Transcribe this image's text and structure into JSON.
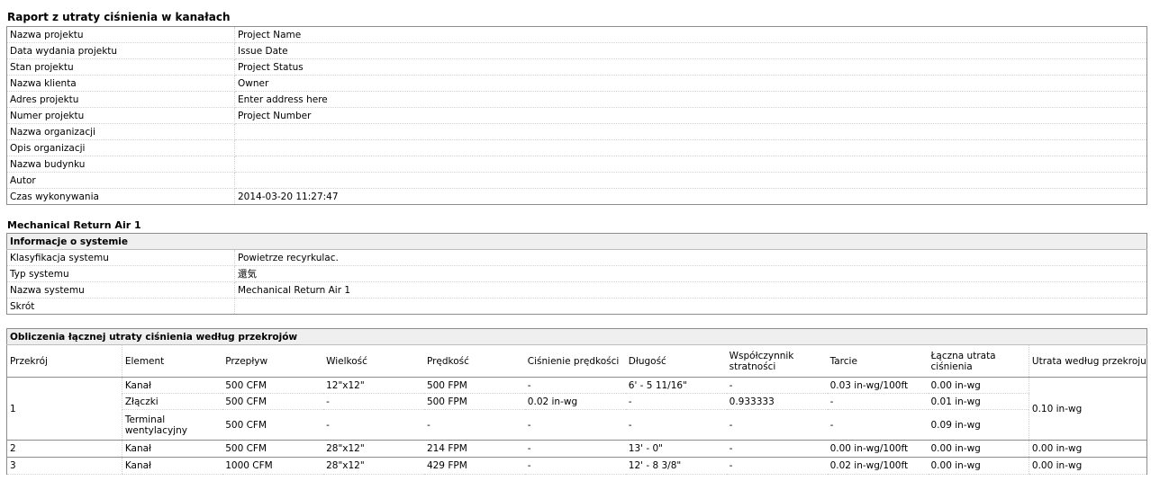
{
  "report_title": "Raport z utraty ciśnienia w kanałach",
  "project_info": [
    {
      "label": "Nazwa projektu",
      "value": "Project Name"
    },
    {
      "label": "Data wydania projektu",
      "value": "Issue Date"
    },
    {
      "label": "Stan projektu",
      "value": "Project Status"
    },
    {
      "label": "Nazwa klienta",
      "value": "Owner"
    },
    {
      "label": "Adres projektu",
      "value": "Enter address here"
    },
    {
      "label": "Numer projektu",
      "value": "Project Number"
    },
    {
      "label": "Nazwa organizacji",
      "value": ""
    },
    {
      "label": "Opis organizacji",
      "value": ""
    },
    {
      "label": "Nazwa budynku",
      "value": ""
    },
    {
      "label": "Autor",
      "value": ""
    },
    {
      "label": "Czas wykonywania",
      "value": "2014-03-20 11:27:47"
    }
  ],
  "system_title": "Mechanical Return Air 1",
  "system_info": {
    "header": "Informacje o systemie",
    "rows": [
      {
        "label": "Klasyfikacja systemu",
        "value": "Powietrze recyrkulac."
      },
      {
        "label": "Typ systemu",
        "value": "還気"
      },
      {
        "label": "Nazwa systemu",
        "value": "Mechanical Return Air 1"
      },
      {
        "label": "Skrót",
        "value": ""
      }
    ]
  },
  "calc": {
    "header": "Obliczenia łącznej utraty ciśnienia według przekrojów",
    "columns": {
      "section": "Przekrój",
      "element": "Element",
      "flow": "Przepływ",
      "size": "Wielkość",
      "velocity": "Prędkość",
      "velocity_pressure": "Ciśnienie prędkości",
      "length": "Długość",
      "loss_coeff_1": "Współczynnik",
      "loss_coeff_2": "stratności",
      "friction": "Tarcie",
      "total_loss_1": "Łączna utrata",
      "total_loss_2": "ciśnienia",
      "section_loss": "Utrata według przekroju"
    },
    "sections": [
      {
        "section": "1",
        "section_loss": "0.10 in-wg",
        "rows": [
          {
            "element": "Kanał",
            "flow": "500 CFM",
            "size": "12\"x12\"",
            "velocity": "500 FPM",
            "velocity_pressure": "-",
            "length": "6' - 5 11/16\"",
            "loss_coeff": "-",
            "friction": "0.03 in-wg/100ft",
            "total_loss": "0.00 in-wg"
          },
          {
            "element": "Złączki",
            "flow": "500 CFM",
            "size": "-",
            "velocity": "500 FPM",
            "velocity_pressure": "0.02 in-wg",
            "length": "-",
            "loss_coeff": "0.933333",
            "friction": "-",
            "total_loss": "0.01 in-wg"
          },
          {
            "element": "Terminal",
            "element2": "wentylacyjny",
            "flow": "500 CFM",
            "size": "-",
            "velocity": "-",
            "velocity_pressure": "-",
            "length": "-",
            "loss_coeff": "-",
            "friction": "-",
            "total_loss": "0.09 in-wg"
          }
        ]
      },
      {
        "section": "2",
        "section_loss": "0.00 in-wg",
        "rows": [
          {
            "element": "Kanał",
            "flow": "500 CFM",
            "size": "28\"x12\"",
            "velocity": "214 FPM",
            "velocity_pressure": "-",
            "length": "13' - 0\"",
            "loss_coeff": "-",
            "friction": "0.00 in-wg/100ft",
            "total_loss": "0.00 in-wg"
          }
        ]
      },
      {
        "section": "3",
        "section_loss": "0.00 in-wg",
        "rows": [
          {
            "element": "Kanał",
            "flow": "1000 CFM",
            "size": "28\"x12\"",
            "velocity": "429 FPM",
            "velocity_pressure": "-",
            "length": "12' - 8 3/8\"",
            "loss_coeff": "-",
            "friction": "0.02 in-wg/100ft",
            "total_loss": "0.00 in-wg"
          }
        ]
      }
    ]
  }
}
